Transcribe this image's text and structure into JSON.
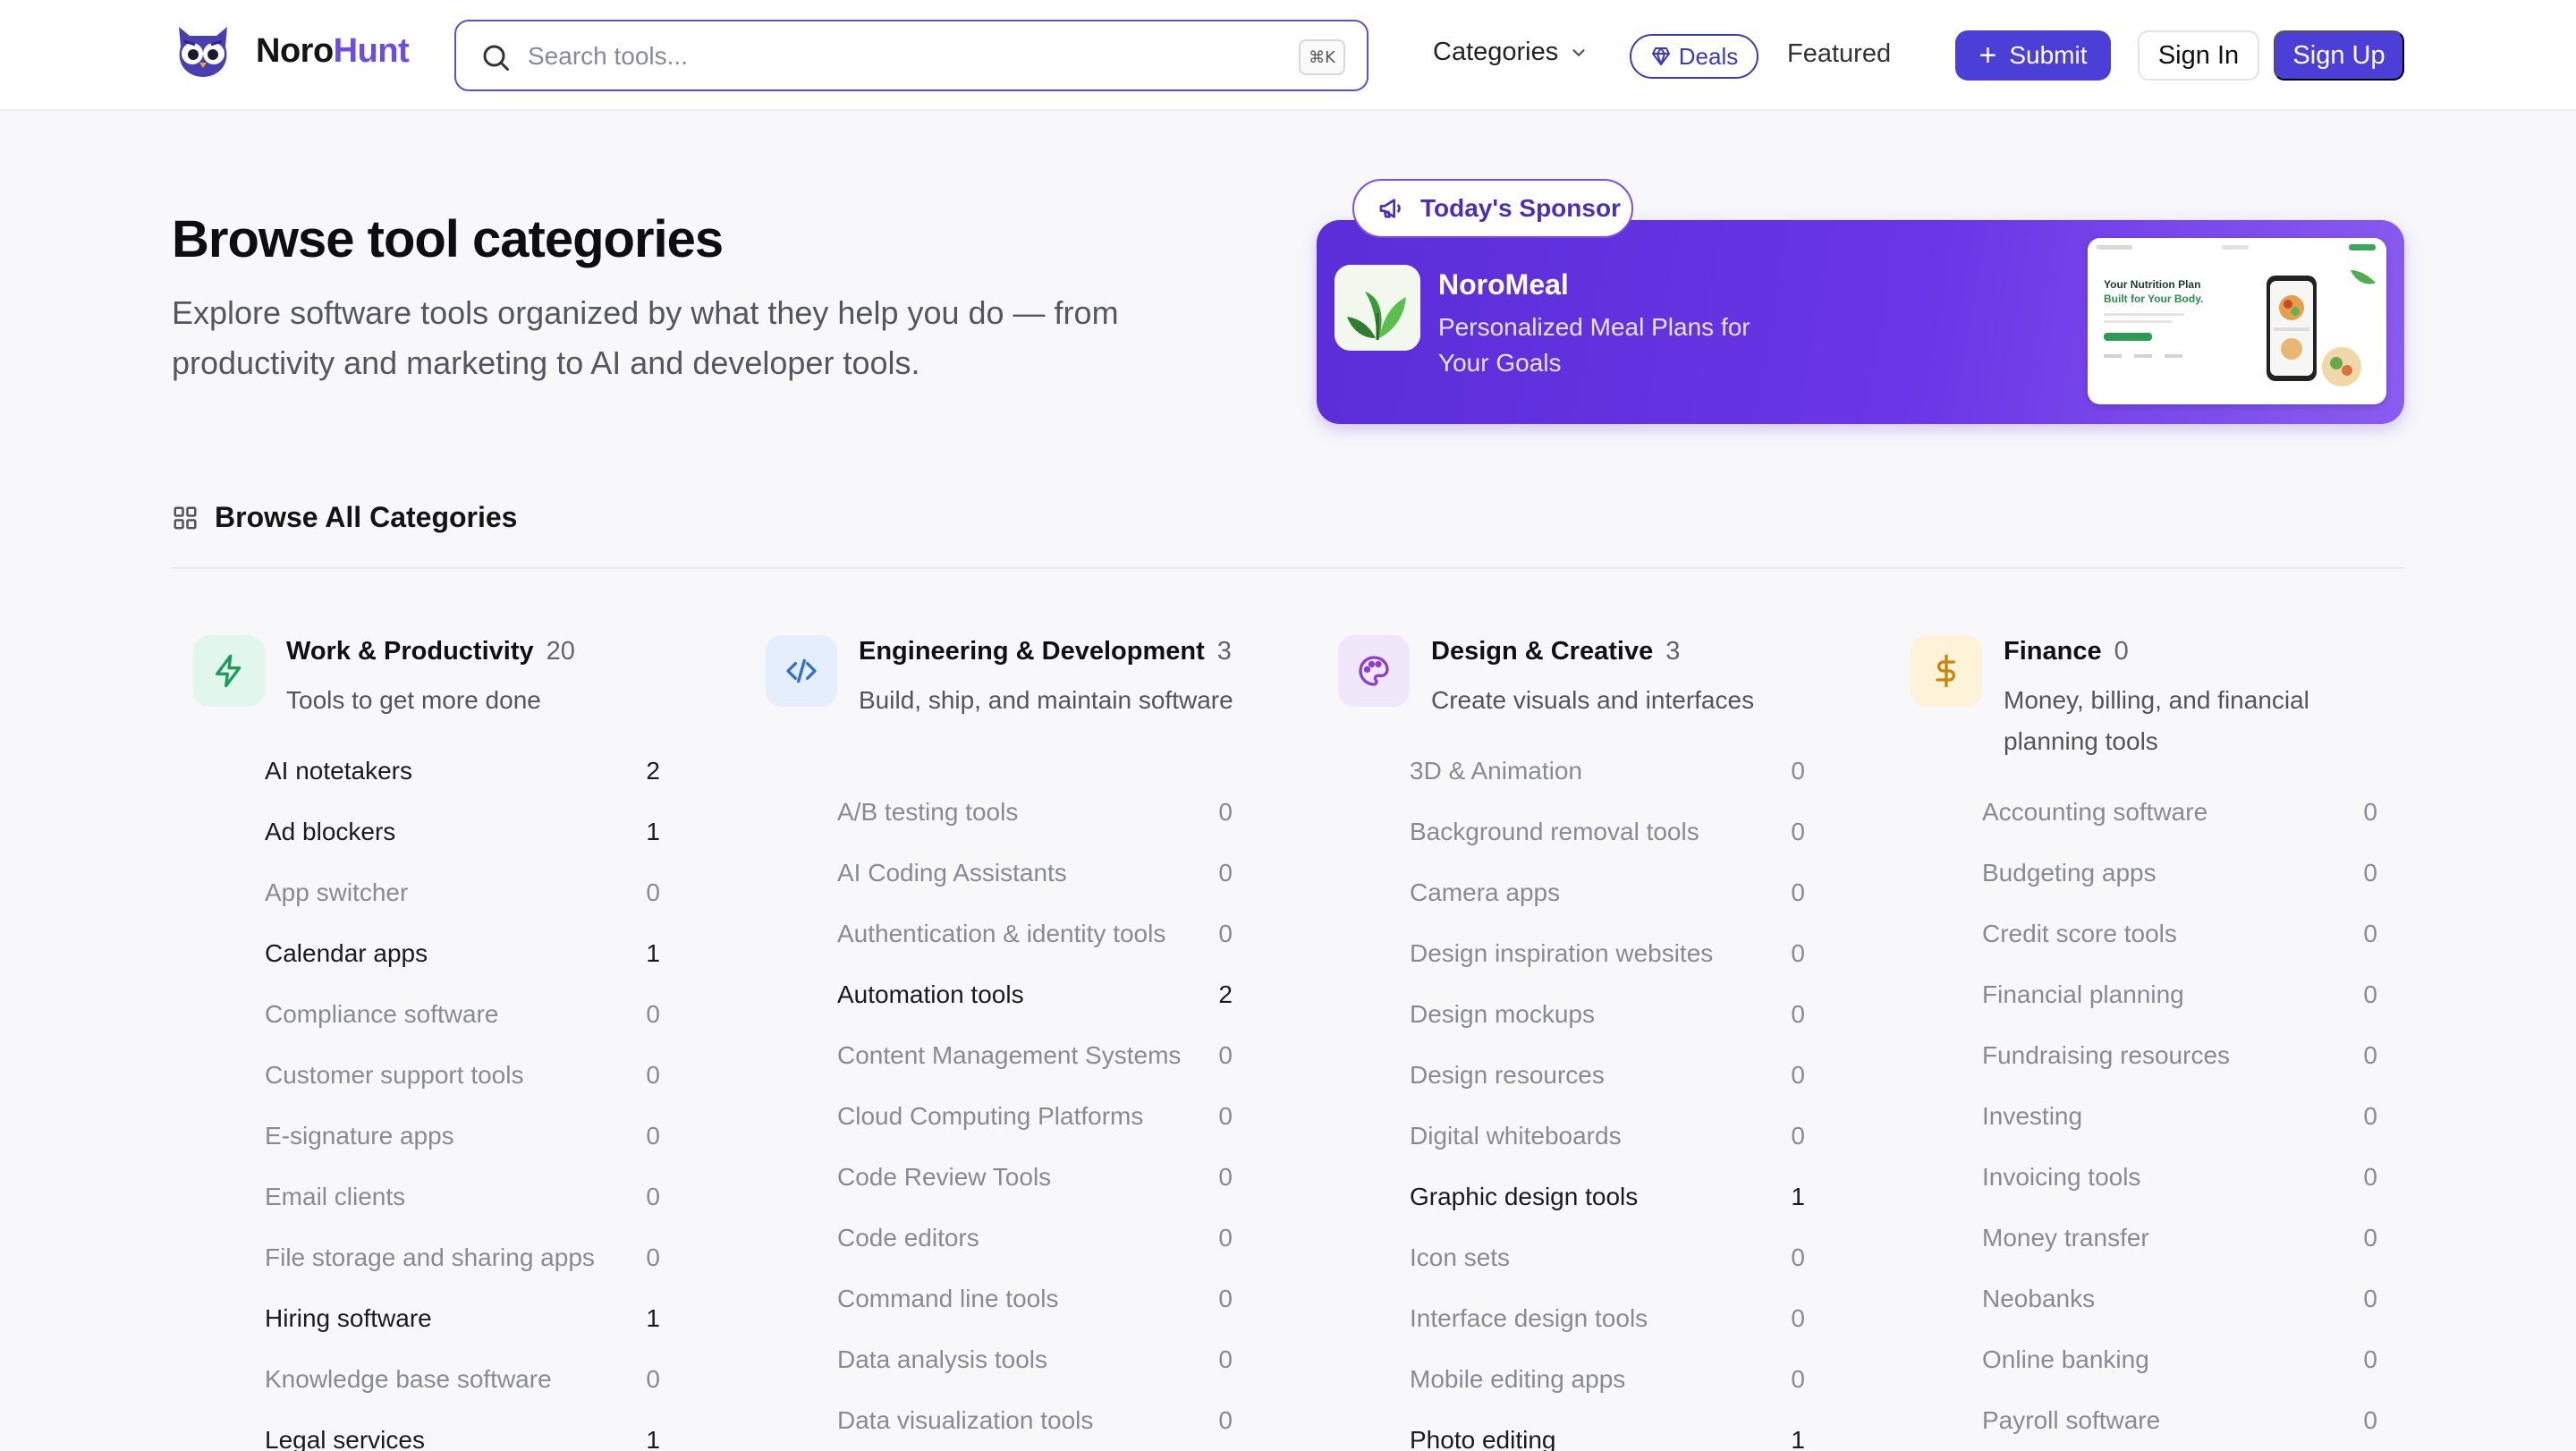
{
  "header": {
    "logo": {
      "part1": "Noro",
      "part2": "Hunt"
    },
    "search": {
      "placeholder": "Search tools...",
      "shortcut": "⌘K"
    },
    "nav": {
      "categories": "Categories",
      "deals": "Deals",
      "featured": "Featured"
    },
    "buttons": {
      "submit": "Submit",
      "sign_in": "Sign In",
      "sign_up": "Sign Up"
    }
  },
  "hero": {
    "title": "Browse tool categories",
    "subtitle": "Explore software tools organized by what they help you do — from productivity and marketing to AI and developer tools."
  },
  "sponsor": {
    "tag": "Today's Sponsor",
    "name": "NoroMeal",
    "description": "Personalized Meal Plans for Your Goals",
    "preview_heading_1": "Your Nutrition Plan",
    "preview_heading_2": "Built for Your Body."
  },
  "browse": {
    "title": "Browse All Categories"
  },
  "colors": {
    "accent": "#4b3fd8",
    "brand": "#6b4ce6",
    "sponsor_gradient_start": "#5a2ed8",
    "sponsor_gradient_end": "#8a5cf0"
  },
  "categories": [
    {
      "title": "Work & Productivity",
      "count": "20",
      "description": "Tools to get more done",
      "icon": "lightning-icon",
      "items": [
        {
          "name": "AI notetakers",
          "count": "2"
        },
        {
          "name": "Ad blockers",
          "count": "1"
        },
        {
          "name": "App switcher",
          "count": "0"
        },
        {
          "name": "Calendar apps",
          "count": "1"
        },
        {
          "name": "Compliance software",
          "count": "0"
        },
        {
          "name": "Customer support tools",
          "count": "0"
        },
        {
          "name": "E-signature apps",
          "count": "0"
        },
        {
          "name": "Email clients",
          "count": "0"
        },
        {
          "name": "File storage and sharing apps",
          "count": "0"
        },
        {
          "name": "Hiring software",
          "count": "1"
        },
        {
          "name": "Knowledge base software",
          "count": "0"
        },
        {
          "name": "Legal services",
          "count": "1"
        }
      ]
    },
    {
      "title": "Engineering & Development",
      "count": "3",
      "description": "Build, ship, and maintain software",
      "icon": "code-icon",
      "items": [
        {
          "name": "A/B testing tools",
          "count": "0"
        },
        {
          "name": "AI Coding Assistants",
          "count": "0"
        },
        {
          "name": "Authentication & identity tools",
          "count": "0"
        },
        {
          "name": "Automation tools",
          "count": "2"
        },
        {
          "name": "Content Management Systems",
          "count": "0"
        },
        {
          "name": "Cloud Computing Platforms",
          "count": "0"
        },
        {
          "name": "Code Review Tools",
          "count": "0"
        },
        {
          "name": "Code editors",
          "count": "0"
        },
        {
          "name": "Command line tools",
          "count": "0"
        },
        {
          "name": "Data analysis tools",
          "count": "0"
        },
        {
          "name": "Data visualization tools",
          "count": "0"
        }
      ]
    },
    {
      "title": "Design & Creative",
      "count": "3",
      "description": "Create visuals and interfaces",
      "icon": "palette-icon",
      "items": [
        {
          "name": "3D & Animation",
          "count": "0"
        },
        {
          "name": "Background removal tools",
          "count": "0"
        },
        {
          "name": "Camera apps",
          "count": "0"
        },
        {
          "name": "Design inspiration websites",
          "count": "0"
        },
        {
          "name": "Design mockups",
          "count": "0"
        },
        {
          "name": "Design resources",
          "count": "0"
        },
        {
          "name": "Digital whiteboards",
          "count": "0"
        },
        {
          "name": "Graphic design tools",
          "count": "1"
        },
        {
          "name": "Icon sets",
          "count": "0"
        },
        {
          "name": "Interface design tools",
          "count": "0"
        },
        {
          "name": "Mobile editing apps",
          "count": "0"
        },
        {
          "name": "Photo editing",
          "count": "1"
        }
      ]
    },
    {
      "title": "Finance",
      "count": "0",
      "description": "Money, billing, and financial planning tools",
      "icon": "dollar-icon",
      "items": [
        {
          "name": "Accounting software",
          "count": "0"
        },
        {
          "name": "Budgeting apps",
          "count": "0"
        },
        {
          "name": "Credit score tools",
          "count": "0"
        },
        {
          "name": "Financial planning",
          "count": "0"
        },
        {
          "name": "Fundraising resources",
          "count": "0"
        },
        {
          "name": "Investing",
          "count": "0"
        },
        {
          "name": "Invoicing tools",
          "count": "0"
        },
        {
          "name": "Money transfer",
          "count": "0"
        },
        {
          "name": "Neobanks",
          "count": "0"
        },
        {
          "name": "Online banking",
          "count": "0"
        },
        {
          "name": "Payroll software",
          "count": "0"
        }
      ]
    }
  ]
}
